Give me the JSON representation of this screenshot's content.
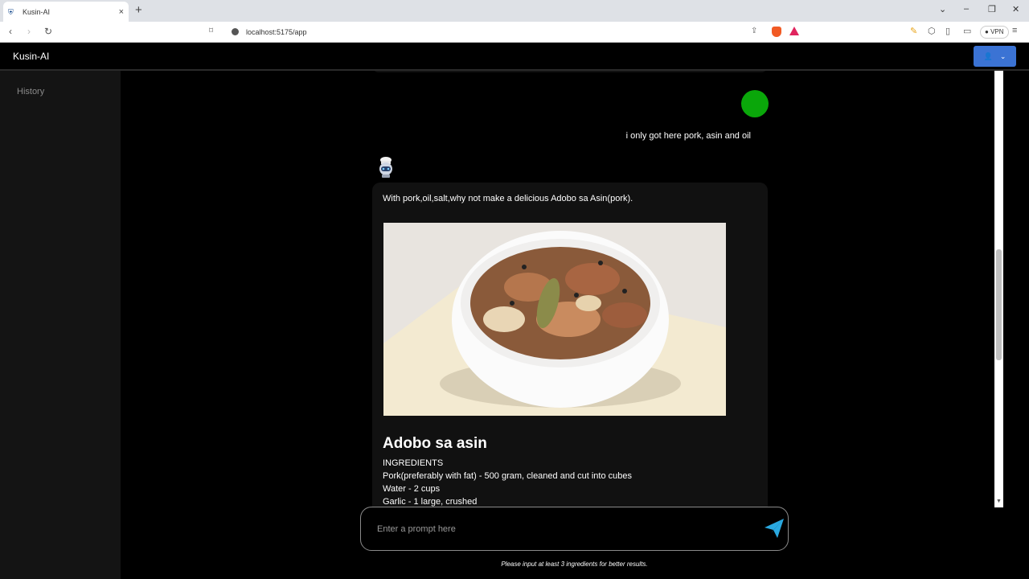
{
  "browser": {
    "tab_title": "Kusin-AI",
    "url": "localhost:5175/app",
    "vpn_label": "VPN"
  },
  "app": {
    "brand": "Kusin-AI"
  },
  "sidebar": {
    "history_label": "History"
  },
  "chat": {
    "user_message": "i only got here pork, asin and oil",
    "bot_intro": "With pork,oil,salt,why not make a delicious Adobo sa Asin(pork).",
    "recipe": {
      "title": "Adobo sa asin",
      "ingredients_heading": "INGREDIENTS",
      "ingredients": [
        "Pork(preferably with fat) - 500 gram, cleaned and cut into cubes",
        "Water - 2 cups",
        "Garlic - 1 large, crushed"
      ]
    }
  },
  "prompt": {
    "placeholder": "Enter a prompt here",
    "hint": "Please input at least 3 ingredients for better results."
  },
  "colors": {
    "accent": "#3b73d4",
    "user_avatar": "#0aa70a",
    "send_icon": "#2aa9e0"
  }
}
